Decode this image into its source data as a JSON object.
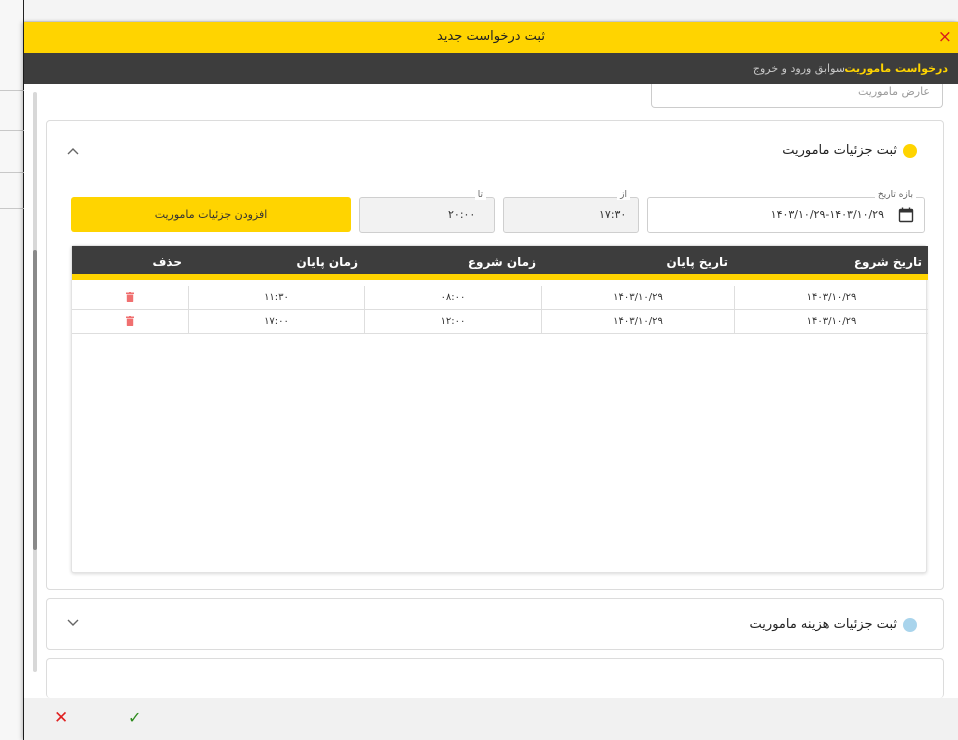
{
  "window": {
    "title": "ثبت درخواست جدید",
    "close_glyph": "×"
  },
  "tabs": [
    {
      "label": "درخواست ماموریت",
      "active": true
    },
    {
      "label": "سوابق ورود و خروج",
      "active": false
    }
  ],
  "top_field": {
    "value": "عارض ماموریت"
  },
  "section_details": {
    "title": "ثبت جزئیات ماموریت",
    "dot_color": "#ffd400",
    "date_range": {
      "label": "بازه تاریخ",
      "value": "۱۴۰۳/۱۰/۲۹-۱۴۰۳/۱۰/۲۹"
    },
    "from": {
      "label": "از",
      "value": "۱۷:۳۰"
    },
    "to": {
      "label": "تا",
      "value": "۲۰:۰۰"
    },
    "add_button": "افزودن جزئیات ماموریت",
    "table": {
      "columns": [
        "تاریخ شروع",
        "تاریخ پایان",
        "زمان شروع",
        "زمان پایان",
        "حذف"
      ],
      "rows": [
        {
          "start_date": "۱۴۰۳/۱۰/۲۹",
          "end_date": "۱۴۰۳/۱۰/۲۹",
          "start_time": "۰۸:۰۰",
          "end_time": "۱۱:۳۰"
        },
        {
          "start_date": "۱۴۰۳/۱۰/۲۹",
          "end_date": "۱۴۰۳/۱۰/۲۹",
          "start_time": "۱۲:۰۰",
          "end_time": "۱۷:۰۰"
        }
      ]
    }
  },
  "section_costs": {
    "title": "ثبت جزئیات هزینه ماموریت",
    "dot_color": "#a9d4ec"
  },
  "footer": {
    "cancel_glyph": "✕",
    "confirm_glyph": "✓"
  },
  "colors": {
    "accent": "#ffd400",
    "header_dark": "#3d3d3d",
    "danger": "#e02020",
    "success": "#2e8b1e",
    "trash": "#f07070"
  }
}
